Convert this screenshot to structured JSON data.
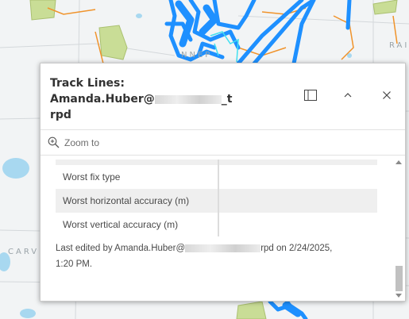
{
  "map_labels": {
    "top": "NNEP",
    "right": "RAI",
    "left": "CARVE"
  },
  "popup": {
    "title_line1": "Track Lines:",
    "title_prefix": "Amanda.Huber@",
    "title_suffix": "_t",
    "title_line3": "rpd",
    "dock_icon": "dock-icon",
    "collapse_icon": "chevron-up-icon",
    "close_icon": "close-icon"
  },
  "actions": {
    "zoom_label": "Zoom to",
    "zoom_icon": "zoom-in-icon"
  },
  "fields": [
    {
      "label": "Worst fix type",
      "value": ""
    },
    {
      "label": "Worst horizontal accuracy (m)",
      "value": ""
    },
    {
      "label": "Worst vertical accuracy (m)",
      "value": ""
    }
  ],
  "edit_info": {
    "prefix": "Last edited by Amanda.Huber@",
    "suffix": "rpd on 2/24/2025,",
    "line2": "1:20 PM."
  },
  "colors": {
    "track_blue": "#1e90ff",
    "highlight_cyan": "#40e0f0",
    "road_orange": "#f0932b",
    "park_green": "#c9dd96",
    "water_blue": "#a8d8f0"
  }
}
